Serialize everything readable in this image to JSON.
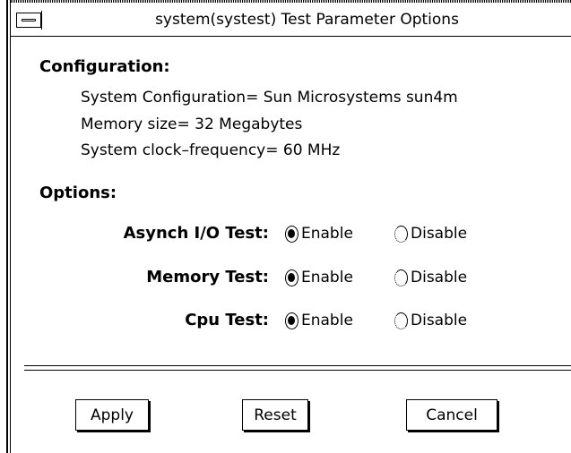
{
  "window": {
    "title": "system(systest) Test Parameter Options"
  },
  "configuration": {
    "heading": "Configuration:",
    "lines": [
      "System Configuration=  Sun Microsystems  sun4m",
      "Memory size= 32 Megabytes",
      "System clock–frequency= 60 MHz"
    ]
  },
  "options": {
    "heading": "Options:",
    "enable_label": "Enable",
    "disable_label": "Disable",
    "items": [
      {
        "label": "Asynch I/O Test:",
        "selected": "Enable"
      },
      {
        "label": "Memory Test:",
        "selected": "Enable"
      },
      {
        "label": "Cpu Test:",
        "selected": "Enable"
      }
    ]
  },
  "buttons": {
    "apply": "Apply",
    "reset": "Reset",
    "cancel": "Cancel"
  }
}
